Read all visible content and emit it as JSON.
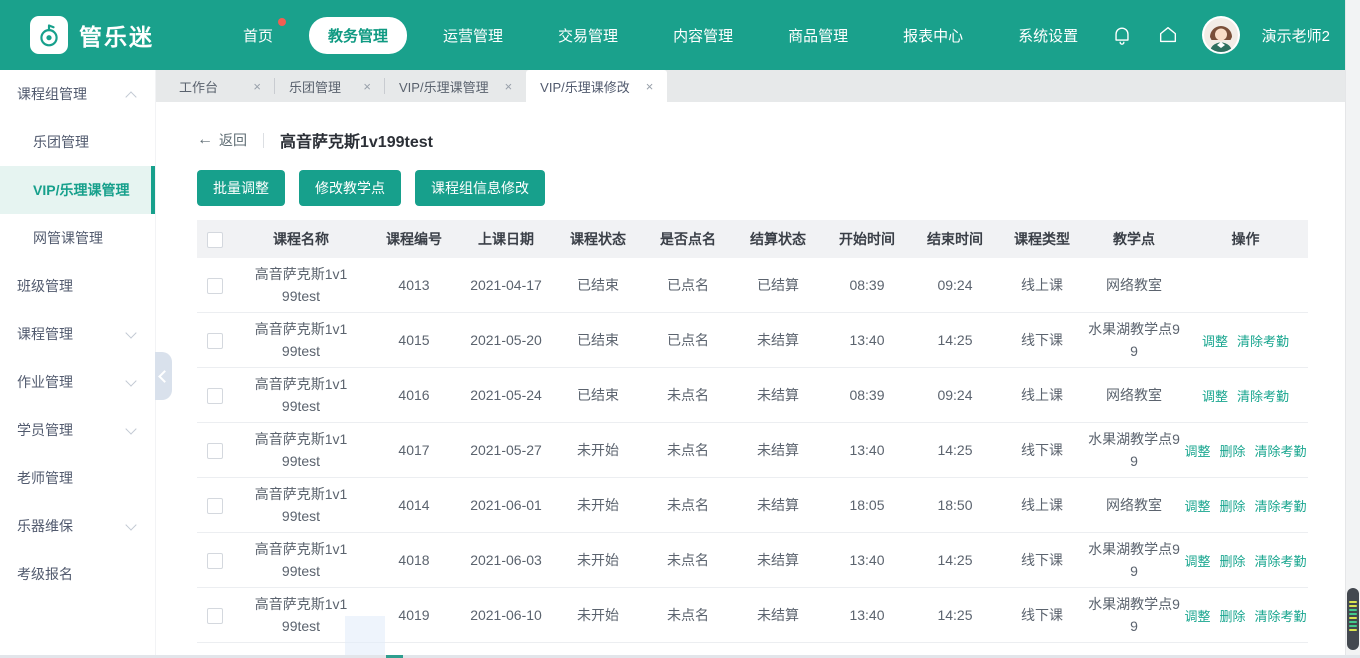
{
  "app": {
    "logo_text": "管乐迷",
    "user_name": "演示老师2"
  },
  "colors": {
    "navbar": "#1AA18C",
    "accent": "#17A08C",
    "link": "#19A68F",
    "sidebar_active_bg": "#E6F4F1",
    "tabbar_bg": "#E7E9EA",
    "badge": "#F25E52"
  },
  "icons": {
    "logo": "music-note-spiral",
    "bell": "bell-outline",
    "home": "home-outline",
    "avatar": "teacher-avatar",
    "nav_badge": "red-dot",
    "tab_close": "×",
    "back_arrow": "←",
    "sidebar_collapse": "chevron-left",
    "expanded": "chevron-up",
    "collapsed": "chevron-down"
  },
  "navbar": {
    "items": [
      {
        "key": "home",
        "label": "首页",
        "active": false,
        "badge": true
      },
      {
        "key": "academic-affairs",
        "label": "教务管理",
        "active": true,
        "badge": false
      },
      {
        "key": "operations",
        "label": "运营管理",
        "active": false,
        "badge": false
      },
      {
        "key": "transactions",
        "label": "交易管理",
        "active": false,
        "badge": false
      },
      {
        "key": "content",
        "label": "内容管理",
        "active": false,
        "badge": false
      },
      {
        "key": "goods",
        "label": "商品管理",
        "active": false,
        "badge": false
      },
      {
        "key": "reports",
        "label": "报表中心",
        "active": false,
        "badge": false
      },
      {
        "key": "settings",
        "label": "系统设置",
        "active": false,
        "badge": false
      }
    ]
  },
  "sidebar": {
    "items": [
      {
        "key": "course-group-mgmt",
        "label": "课程组管理",
        "level": 1,
        "chevron": "up",
        "active": false
      },
      {
        "key": "band-mgmt",
        "label": "乐团管理",
        "level": 2,
        "chevron": "",
        "active": false
      },
      {
        "key": "vip-theory-course-mgmt",
        "label": "VIP/乐理课管理",
        "level": 2,
        "chevron": "",
        "active": true
      },
      {
        "key": "online-admin-course-mgmt",
        "label": "网管课管理",
        "level": 2,
        "chevron": "",
        "active": false
      },
      {
        "key": "class-mgmt",
        "label": "班级管理",
        "level": 1,
        "chevron": "",
        "active": false
      },
      {
        "key": "course-mgmt",
        "label": "课程管理",
        "level": 1,
        "chevron": "down",
        "active": false
      },
      {
        "key": "homework-mgmt",
        "label": "作业管理",
        "level": 1,
        "chevron": "down",
        "active": false
      },
      {
        "key": "student-mgmt",
        "label": "学员管理",
        "level": 1,
        "chevron": "down",
        "active": false
      },
      {
        "key": "teacher-mgmt",
        "label": "老师管理",
        "level": 1,
        "chevron": "",
        "active": false
      },
      {
        "key": "instrument-maintenance",
        "label": "乐器维保",
        "level": 1,
        "chevron": "down",
        "active": false
      },
      {
        "key": "exam-registration",
        "label": "考级报名",
        "level": 1,
        "chevron": "",
        "active": false
      }
    ]
  },
  "tabbar": {
    "tabs": [
      {
        "key": "workbench",
        "label": "工作台",
        "active": false
      },
      {
        "key": "band-mgmt",
        "label": "乐团管理",
        "active": false
      },
      {
        "key": "vip-theory-course-mgmt",
        "label": "VIP/乐理课管理",
        "active": false
      },
      {
        "key": "vip-theory-course-edit",
        "label": "VIP/乐理课修改",
        "active": true
      }
    ]
  },
  "page": {
    "back_label": "返回",
    "title": "高音萨克斯1v199test",
    "buttons": [
      {
        "key": "batch-adjust",
        "label": "批量调整"
      },
      {
        "key": "change-teaching-point",
        "label": "修改教学点"
      },
      {
        "key": "edit-course-group-info",
        "label": "课程组信息修改"
      }
    ]
  },
  "table": {
    "columns": [
      "课程名称",
      "课程编号",
      "上课日期",
      "课程状态",
      "是否点名",
      "结算状态",
      "开始时间",
      "结束时间",
      "课程类型",
      "教学点",
      "操作"
    ],
    "action_keys": {
      "调整": "adjust-link",
      "删除": "delete-link",
      "清除考勤": "clear-attendance-link"
    },
    "rows": [
      {
        "name": "高音萨克斯1v199test",
        "code": "4013",
        "date": "2021-04-17",
        "status": "已结束",
        "rollcall": "已点名",
        "settle": "已结算",
        "start": "08:39",
        "end": "09:24",
        "type": "线上课",
        "venue": "网络教室",
        "actions": []
      },
      {
        "name": "高音萨克斯1v199test",
        "code": "4015",
        "date": "2021-05-20",
        "status": "已结束",
        "rollcall": "已点名",
        "settle": "未结算",
        "start": "13:40",
        "end": "14:25",
        "type": "线下课",
        "venue": "水果湖教学点99",
        "actions": [
          "调整",
          "清除考勤"
        ]
      },
      {
        "name": "高音萨克斯1v199test",
        "code": "4016",
        "date": "2021-05-24",
        "status": "已结束",
        "rollcall": "未点名",
        "settle": "未结算",
        "start": "08:39",
        "end": "09:24",
        "type": "线上课",
        "venue": "网络教室",
        "actions": [
          "调整",
          "清除考勤"
        ]
      },
      {
        "name": "高音萨克斯1v199test",
        "code": "4017",
        "date": "2021-05-27",
        "status": "未开始",
        "rollcall": "未点名",
        "settle": "未结算",
        "start": "13:40",
        "end": "14:25",
        "type": "线下课",
        "venue": "水果湖教学点99",
        "actions": [
          "调整",
          "删除",
          "清除考勤"
        ]
      },
      {
        "name": "高音萨克斯1v199test",
        "code": "4014",
        "date": "2021-06-01",
        "status": "未开始",
        "rollcall": "未点名",
        "settle": "未结算",
        "start": "18:05",
        "end": "18:50",
        "type": "线上课",
        "venue": "网络教室",
        "actions": [
          "调整",
          "删除",
          "清除考勤"
        ]
      },
      {
        "name": "高音萨克斯1v199test",
        "code": "4018",
        "date": "2021-06-03",
        "status": "未开始",
        "rollcall": "未点名",
        "settle": "未结算",
        "start": "13:40",
        "end": "14:25",
        "type": "线下课",
        "venue": "水果湖教学点99",
        "actions": [
          "调整",
          "删除",
          "清除考勤"
        ]
      },
      {
        "name": "高音萨克斯1v199test",
        "code": "4019",
        "date": "2021-06-10",
        "status": "未开始",
        "rollcall": "未点名",
        "settle": "未结算",
        "start": "13:40",
        "end": "14:25",
        "type": "线下课",
        "venue": "水果湖教学点99",
        "actions": [
          "调整",
          "删除",
          "清除考勤"
        ]
      }
    ]
  },
  "scrollbar_stripes": [
    "#d9e34f",
    "#d9e34f",
    "#45c98c",
    "#45c98c",
    "#d9e34f",
    "#45c98c",
    "#45c98c",
    "#d9e34f"
  ]
}
